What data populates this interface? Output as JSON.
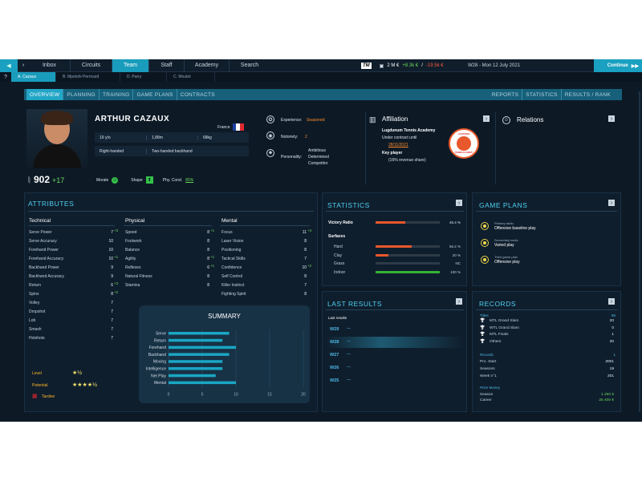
{
  "topbar": {
    "tabs": [
      "Inbox",
      "Circuits",
      "Team",
      "Staff",
      "Academy",
      "Search"
    ],
    "active": "Team",
    "balance": "2 M €",
    "income": "+8.3k €",
    "expense": "-19.5k €",
    "date": "W28 - Mon 12 July 2021",
    "continue": "Continue",
    "tm_logo": "TM"
  },
  "player_tabs": [
    "A. Cazaux",
    "B. Mpetshi Perricard",
    "D. Parry",
    "C. Moutet"
  ],
  "profile_nav": {
    "left": [
      "OVERVIEW",
      "PLANNING",
      "TRAINING",
      "GAME PLANS",
      "CONTRACTS"
    ],
    "right": [
      "REPORTS",
      "STATISTICS",
      "RESULTS / RANK"
    ]
  },
  "player": {
    "name": "ARTHUR CAZAUX",
    "country": "France",
    "age": "19 y/o",
    "height": "1,88m",
    "weight": "68kg",
    "hand": "Right-handed",
    "backhand": "Two-handed backhand",
    "ranking_prefix": "ATP",
    "ranking": "902",
    "ranking_change": "+17",
    "morale_label": "Morale",
    "shape_label": "Shape",
    "phy_label": "Phy. Cond.",
    "phy_value": "80%"
  },
  "traits": {
    "experience_label": "Experience:",
    "experience": "Seasoned",
    "notoriety_label": "Notoriety:",
    "notoriety": "2",
    "personality_label": "Personality:",
    "personality": [
      "Ambitious",
      "Determined",
      "Competitor"
    ]
  },
  "affiliation": {
    "title": "Affiliation",
    "club": "Lugdunum Tennis Academy",
    "contract": "Under contract until",
    "date": "28/11/2021",
    "key_label": "Key player",
    "revenue": "(16% revenue share)",
    "logo_top": "LUGDUNUM",
    "logo_bottom": "TENNIS ACADEMY"
  },
  "relations": {
    "title": "Relations"
  },
  "attributes": {
    "title": "ATTRIBUTES",
    "technical": {
      "title": "Technical",
      "rows": [
        [
          "Serve Power",
          "7",
          "+3"
        ],
        [
          "Serve Accuracy",
          "10",
          ""
        ],
        [
          "Forehand Power",
          "10",
          ""
        ],
        [
          "Forehand Accuracy",
          "10",
          "+1"
        ],
        [
          "Backhand Power",
          "9",
          ""
        ],
        [
          "Backhand Accuracy",
          "9",
          ""
        ],
        [
          "Return",
          "6",
          "+3"
        ],
        [
          "Spins",
          "8",
          "+2"
        ],
        [
          "Volley",
          "7",
          ""
        ],
        [
          "Dropshot",
          "7",
          ""
        ],
        [
          "Lob",
          "7",
          ""
        ],
        [
          "Smash",
          "7",
          ""
        ],
        [
          "Hotshots",
          "7",
          ""
        ]
      ]
    },
    "physical": {
      "title": "Physical",
      "rows": [
        [
          "Speed",
          "8",
          "+1"
        ],
        [
          "Footwork",
          "8",
          ""
        ],
        [
          "Balance",
          "8",
          ""
        ],
        [
          "Agility",
          "8",
          "+1"
        ],
        [
          "Reflexes",
          "6",
          "+1"
        ],
        [
          "Natural Fitness",
          "8",
          ""
        ],
        [
          "Stamina",
          "8",
          ""
        ]
      ]
    },
    "mental": {
      "title": "Mental",
      "rows": [
        [
          "Focus",
          "11",
          "+3"
        ],
        [
          "Laser Vision",
          "8",
          ""
        ],
        [
          "Positioning",
          "8",
          ""
        ],
        [
          "Tactical Skills",
          "7",
          ""
        ],
        [
          "Confidence",
          "10",
          "+2"
        ],
        [
          "Self Control",
          "8",
          ""
        ],
        [
          "Killer Instinct",
          "7",
          ""
        ],
        [
          "Fighting Spirit",
          "8",
          ""
        ]
      ]
    },
    "level_label": "Level",
    "level_stars": "★½",
    "potential_label": "Potential",
    "potential_stars": "★★★★½",
    "tardive": "Tardive"
  },
  "summary": {
    "title": "SUMMARY"
  },
  "chart_data": {
    "type": "bar",
    "title": "SUMMARY",
    "categories": [
      "Serve",
      "Return",
      "Forehand",
      "Backhand",
      "Moving",
      "Intelligence",
      "Net Play",
      "Mental"
    ],
    "values": [
      9,
      8,
      10,
      9,
      8,
      8,
      7,
      10
    ],
    "xlim": [
      0,
      20
    ],
    "xticks": [
      "0",
      "5",
      "10",
      "15",
      "20"
    ]
  },
  "statistics": {
    "title": "STATISTICS",
    "victory_label": "Victory Ratio",
    "victory_value": "46.4 %",
    "victory_ratio": 0.464,
    "surfaces_label": "Surfaces",
    "surfaces": [
      {
        "name": "Hard",
        "value": "56.2 %",
        "ratio": 0.562,
        "color": "#e8582c"
      },
      {
        "name": "Clay",
        "value": "20 %",
        "ratio": 0.2,
        "color": "#e8582c"
      },
      {
        "name": "Grass",
        "value": "NC",
        "ratio": 0,
        "color": "#555"
      },
      {
        "name": "Indoor",
        "value": "100 %",
        "ratio": 1.0,
        "color": "#34b234"
      }
    ]
  },
  "game_plans": {
    "title": "GAME PLANS",
    "items": [
      {
        "label": "Primary tactic",
        "value": "Offensive baseline play"
      },
      {
        "label": "Secondary tactic",
        "value": "Varied play"
      },
      {
        "label": "Third game plan",
        "value": "Offensive play"
      }
    ]
  },
  "last_results": {
    "title": "LAST RESULTS",
    "subtitle": "Last results",
    "weeks": [
      "W29",
      "W28",
      "W27",
      "W26",
      "W25"
    ]
  },
  "records": {
    "title": "RECORDS",
    "titles_label": "Titles",
    "titles_total": "85",
    "titles": [
      [
        "MTL Grand Slam",
        "20"
      ],
      [
        "WTL Grand Slam",
        "0"
      ],
      [
        "MTL Finals",
        "1"
      ],
      [
        "Others",
        "30"
      ]
    ],
    "records_label": "Records",
    "records_total": "1",
    "records": [
      [
        "Pro. Start",
        "2001"
      ],
      [
        "Seasons",
        "19"
      ],
      [
        "Week n°1",
        "201"
      ]
    ],
    "prize_label": "Prize Money",
    "prize": [
      [
        "Season",
        "1 250 €"
      ],
      [
        "Career",
        "25 400 €"
      ]
    ]
  }
}
